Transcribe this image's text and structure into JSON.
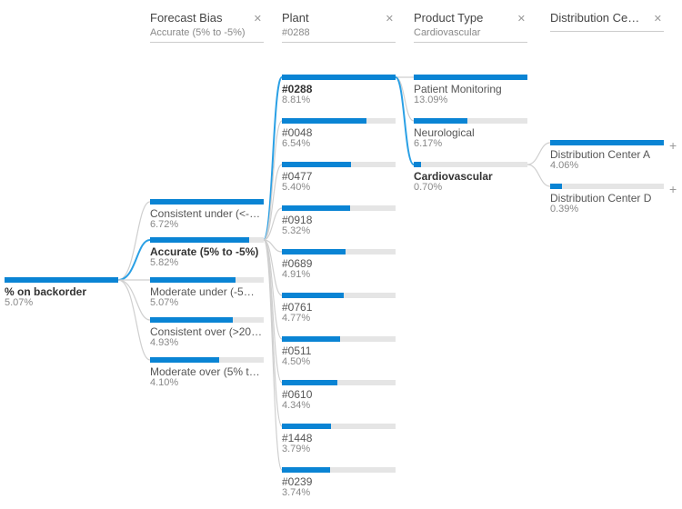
{
  "chart_data": {
    "type": "decomposition-tree",
    "metric": "% on backorder",
    "root_value": 5.07,
    "levels": [
      {
        "name": "Forecast Bias",
        "selected": "Accurate (5% to -5%)"
      },
      {
        "name": "Plant",
        "selected": "#0288"
      },
      {
        "name": "Product Type",
        "selected": "Cardiovascular"
      },
      {
        "name": "Distribution Cent…",
        "selected": null
      }
    ],
    "nodes": {
      "forecast_bias": [
        {
          "label": "Consistent under (<-2…",
          "value": 6.72
        },
        {
          "label": "Accurate (5% to -5%)",
          "value": 5.82,
          "selected": true
        },
        {
          "label": "Moderate under (-5% …",
          "value": 5.07
        },
        {
          "label": "Consistent over (>20%)",
          "value": 4.93
        },
        {
          "label": "Moderate over (5% to …",
          "value": 4.1
        }
      ],
      "plant": [
        {
          "label": "#0288",
          "value": 8.81,
          "selected": true
        },
        {
          "label": "#0048",
          "value": 6.54
        },
        {
          "label": "#0477",
          "value": 5.4
        },
        {
          "label": "#0918",
          "value": 5.32
        },
        {
          "label": "#0689",
          "value": 4.91
        },
        {
          "label": "#0761",
          "value": 4.77
        },
        {
          "label": "#0511",
          "value": 4.5
        },
        {
          "label": "#0610",
          "value": 4.34
        },
        {
          "label": "#1448",
          "value": 3.79
        },
        {
          "label": "#0239",
          "value": 3.74
        }
      ],
      "product_type": [
        {
          "label": "Patient Monitoring",
          "value": 13.09
        },
        {
          "label": "Neurological",
          "value": 6.17
        },
        {
          "label": "Cardiovascular",
          "value": 0.7,
          "selected": true
        }
      ],
      "distribution_center": [
        {
          "label": "Distribution Center A",
          "value": 4.06
        },
        {
          "label": "Distribution Center D",
          "value": 0.39
        }
      ]
    }
  },
  "scales": {
    "forecast_bias_max": 6.72,
    "plant_max": 8.81,
    "product_type_max": 13.09,
    "distribution_center_max": 4.06
  },
  "headers": {
    "forecast_bias": {
      "title": "Forecast Bias",
      "sub": "Accurate (5% to -5%)"
    },
    "plant": {
      "title": "Plant",
      "sub": "#0288"
    },
    "product_type": {
      "title": "Product Type",
      "sub": "Cardiovascular"
    },
    "distribution_center": {
      "title": "Distribution Cent…",
      "sub": ""
    }
  },
  "root": {
    "label": "% on backorder",
    "value": "5.07%"
  },
  "close_glyph": "✕",
  "plus_glyph": "+",
  "forecast_bias": {
    "0": {
      "label": "Consistent under (<-2…",
      "value": "6.72%",
      "pct": 100
    },
    "1": {
      "label": "Accurate (5% to -5%)",
      "value": "5.82%",
      "pct": 87
    },
    "2": {
      "label": "Moderate under (-5% …",
      "value": "5.07%",
      "pct": 75
    },
    "3": {
      "label": "Consistent over (>20%)",
      "value": "4.93%",
      "pct": 73
    },
    "4": {
      "label": "Moderate over (5% to …",
      "value": "4.10%",
      "pct": 61
    }
  },
  "plant": {
    "0": {
      "label": "#0288",
      "value": "8.81%",
      "pct": 100
    },
    "1": {
      "label": "#0048",
      "value": "6.54%",
      "pct": 74
    },
    "2": {
      "label": "#0477",
      "value": "5.40%",
      "pct": 61
    },
    "3": {
      "label": "#0918",
      "value": "5.32%",
      "pct": 60
    },
    "4": {
      "label": "#0689",
      "value": "4.91%",
      "pct": 56
    },
    "5": {
      "label": "#0761",
      "value": "4.77%",
      "pct": 54
    },
    "6": {
      "label": "#0511",
      "value": "4.50%",
      "pct": 51
    },
    "7": {
      "label": "#0610",
      "value": "4.34%",
      "pct": 49
    },
    "8": {
      "label": "#1448",
      "value": "3.79%",
      "pct": 43
    },
    "9": {
      "label": "#0239",
      "value": "3.74%",
      "pct": 42
    }
  },
  "product_type": {
    "0": {
      "label": "Patient Monitoring",
      "value": "13.09%",
      "pct": 100
    },
    "1": {
      "label": "Neurological",
      "value": "6.17%",
      "pct": 47
    },
    "2": {
      "label": "Cardiovascular",
      "value": "0.70%",
      "pct": 6
    }
  },
  "distribution_center": {
    "0": {
      "label": "Distribution Center A",
      "value": "4.06%",
      "pct": 100
    },
    "1": {
      "label": "Distribution Center D",
      "value": "0.39%",
      "pct": 10
    }
  }
}
